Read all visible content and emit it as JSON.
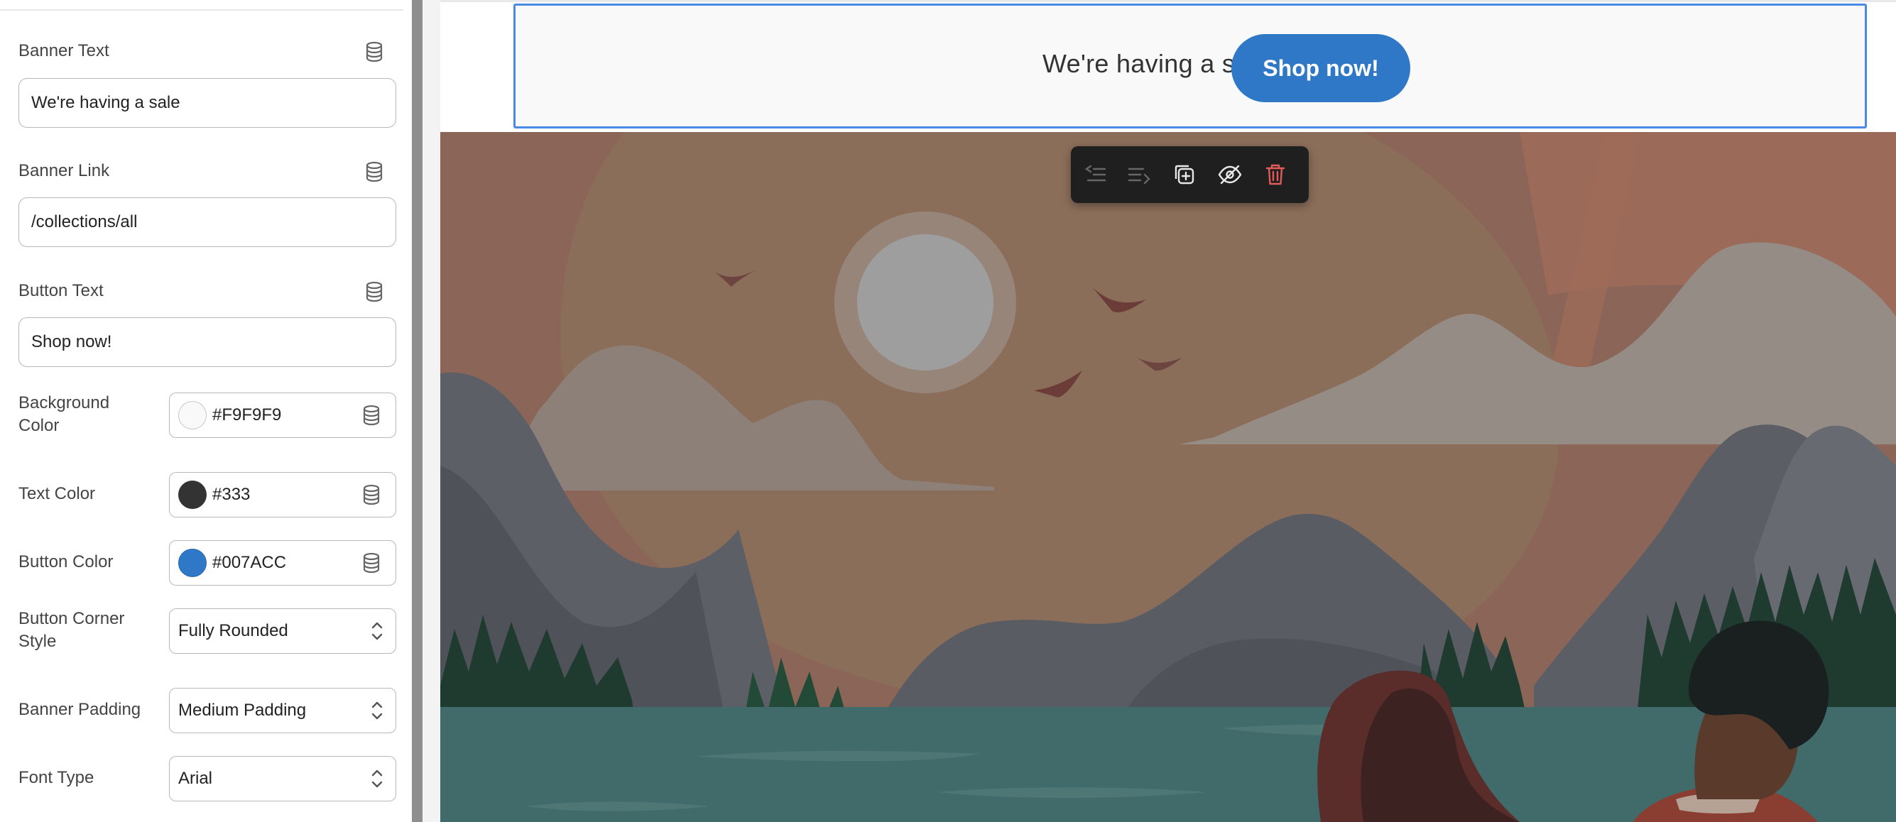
{
  "settings": {
    "banner_text": {
      "label": "Banner Text",
      "value": "We're having a sale"
    },
    "banner_link": {
      "label": "Banner Link",
      "value": "/collections/all"
    },
    "button_text": {
      "label": "Button Text",
      "value": "Shop now!"
    },
    "background_color": {
      "label_line1": "Background",
      "label_line2": "Color",
      "value": "#F9F9F9",
      "swatch": "#F9F9F9"
    },
    "text_color": {
      "label": "Text Color",
      "value": "#333",
      "swatch": "#333333"
    },
    "button_color": {
      "label": "Button Color",
      "value": "#007ACC",
      "swatch": "#2f78c7"
    },
    "button_corner_style": {
      "label_line1": "Button Corner",
      "label_line2": "Style",
      "value": "Fully Rounded"
    },
    "banner_padding": {
      "label": "Banner Padding",
      "value": "Medium Padding"
    },
    "font_type": {
      "label": "Font Type",
      "value": "Arial"
    },
    "binding_icon": "database-icon"
  },
  "preview": {
    "banner_text": "We're having a sale",
    "button_text": "Shop now!",
    "toolbar_icons": [
      "outdent-icon",
      "indent-icon",
      "duplicate-icon",
      "hide-icon",
      "delete-icon"
    ]
  }
}
